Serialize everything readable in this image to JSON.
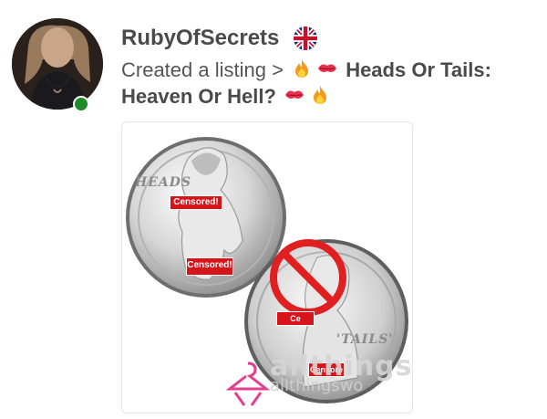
{
  "post": {
    "username": "RubyOfSecrets",
    "flag_icon": "uk-flag-icon",
    "activity_prefix": "Created a listing >",
    "listing_title": "Heads Or Tails: Heaven Or Hell?",
    "title_emojis_before": [
      "fire-emoji",
      "kiss-emoji"
    ],
    "title_emojis_after": [
      "kiss-emoji",
      "fire-emoji"
    ],
    "online": true
  },
  "listing_image": {
    "coin_heads_label": "HEADS",
    "coin_tails_label": "'TAILS'",
    "censor_label": "Censored!",
    "censor_partial_1": "Ce",
    "censor_partial_2": "Censore",
    "watermark_large": "allthings",
    "watermark_small": "allthingswo"
  },
  "colors": {
    "online": "#1f8a2a",
    "censor_red": "#d7141a",
    "no_symbol_red": "#e02020",
    "watermark_pink": "#e33f8f"
  }
}
